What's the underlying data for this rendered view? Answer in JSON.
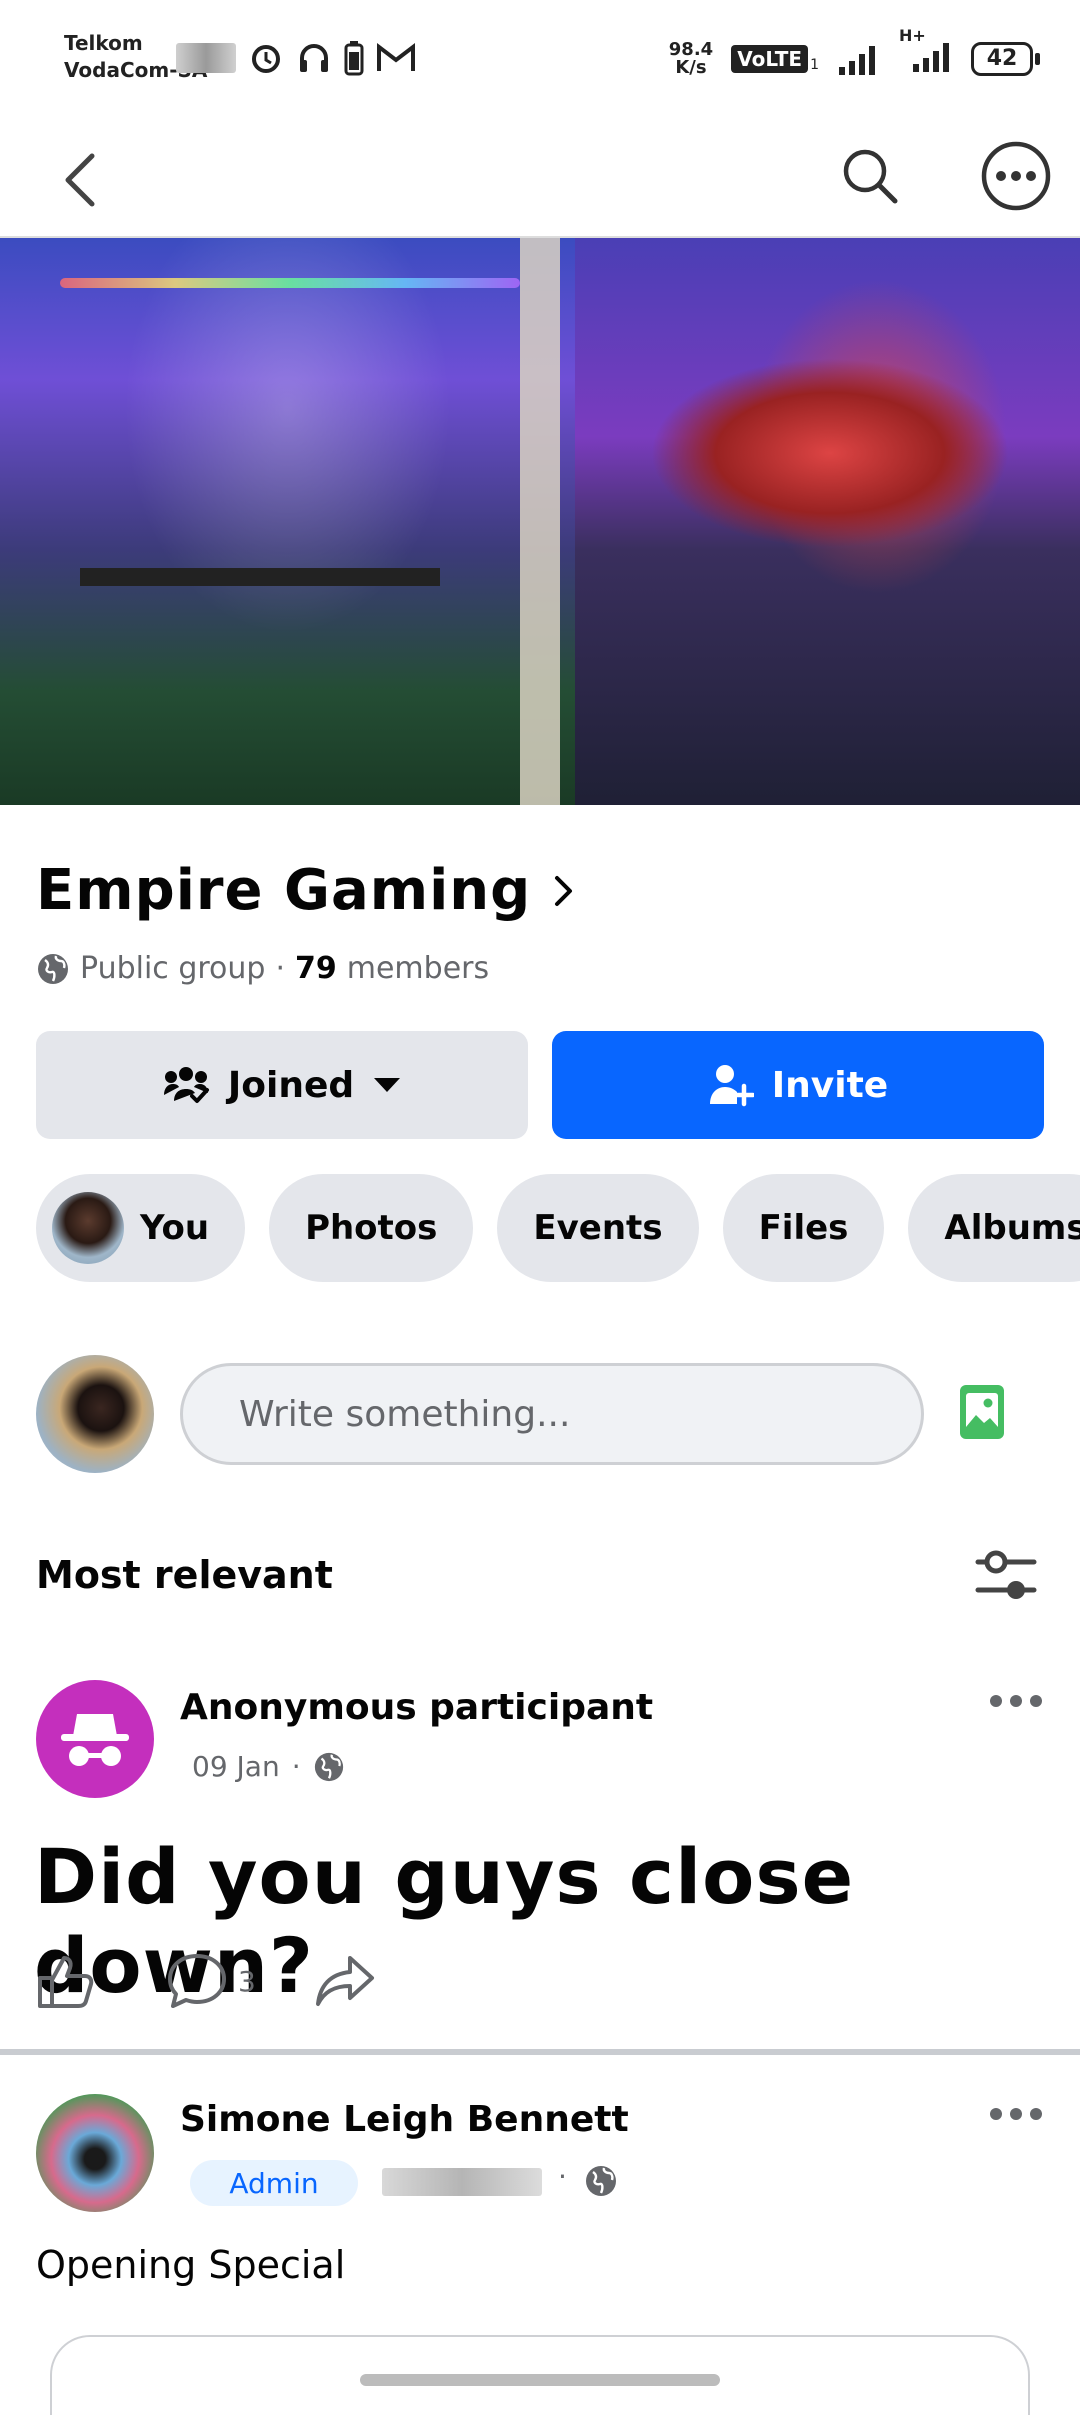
{
  "status_bar": {
    "carrier_1": "Telkom",
    "carrier_2": "VodaCom-SA",
    "net_speed_value": "98.4",
    "net_speed_unit": "K/s",
    "volte": "VoLTE",
    "volte_sub": "1",
    "signal_2_label": "H+",
    "battery": "42"
  },
  "group": {
    "name": "Empire Gaming",
    "privacy": "Public group",
    "member_count": "79",
    "members_label": "members"
  },
  "actions": {
    "joined_label": "Joined",
    "invite_label": "Invite"
  },
  "chips": [
    "You",
    "Photos",
    "Events",
    "Files",
    "Albums"
  ],
  "composer": {
    "placeholder": "Write something..."
  },
  "feed": {
    "sort_label": "Most relevant"
  },
  "posts": [
    {
      "author": "Anonymous participant",
      "date": "09 Jan",
      "text": "Did you guys close down?",
      "comment_count": "3"
    },
    {
      "author": "Simone Leigh Bennett",
      "badge": "Admin",
      "text": "Opening Special"
    }
  ],
  "colors": {
    "primary": "#0866ff",
    "anon_avatar": "#c42fbd",
    "chip_bg": "#e4e6eb",
    "photo_icon": "#45bd62"
  }
}
